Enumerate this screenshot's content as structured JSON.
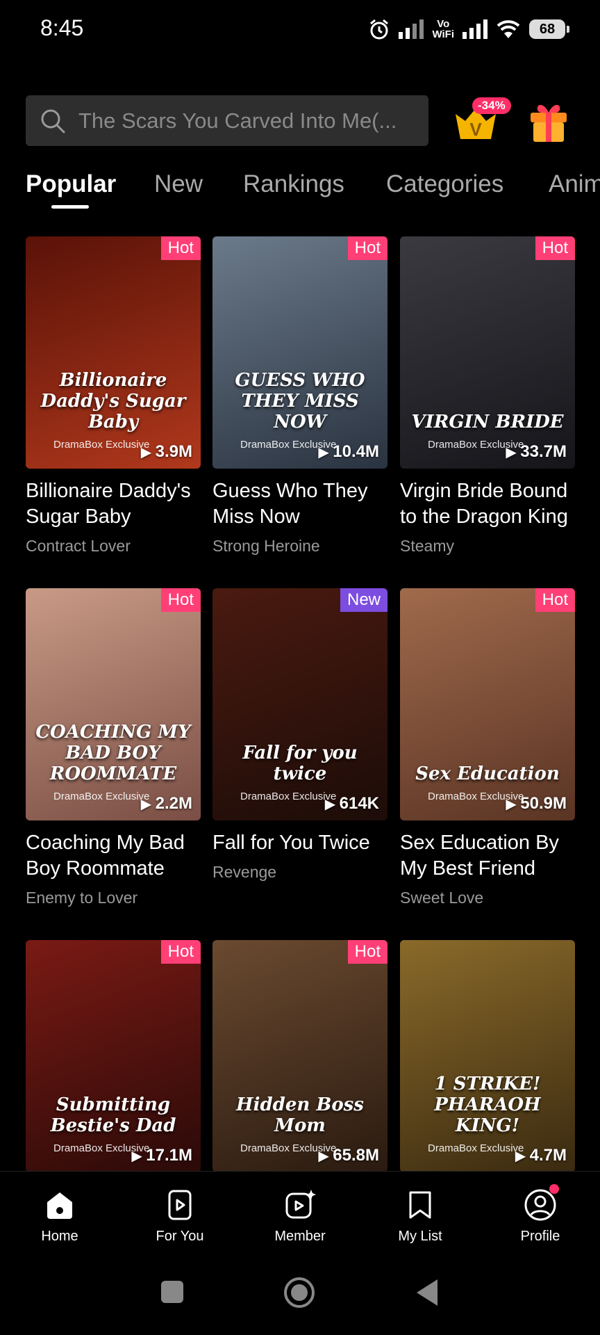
{
  "status": {
    "time": "8:45",
    "vowifi_top": "Vo",
    "vowifi_bottom": "WiFi",
    "battery": "68"
  },
  "search": {
    "placeholder": "The Scars You Carved Into Me(..."
  },
  "vip": {
    "discount": "-34%",
    "letter": "V"
  },
  "tabs": [
    {
      "label": "Popular"
    },
    {
      "label": "New"
    },
    {
      "label": "Rankings"
    },
    {
      "label": "Categories"
    },
    {
      "label": "Anim"
    }
  ],
  "exclusive_label": "DramaBox Exclusive",
  "cards": [
    {
      "title": "Billionaire Daddy's Sugar Baby",
      "tag": "Contract Lover",
      "badge": "Hot",
      "views": "3.9M",
      "cover_text": "Billionaire Daddy's Sugar Baby",
      "colors": [
        "#5a1208",
        "#b0381c"
      ]
    },
    {
      "title": "Guess Who They Miss Now",
      "tag": "Strong Heroine",
      "badge": "Hot",
      "views": "10.4M",
      "cover_text": "GUESS WHO THEY MISS NOW",
      "colors": [
        "#6b7a8a",
        "#2a3340"
      ]
    },
    {
      "title": "Virgin Bride Bound to the Dragon King",
      "tag": "Steamy",
      "badge": "Hot",
      "views": "33.7M",
      "cover_text": "VIRGIN BRIDE",
      "colors": [
        "#3a3a40",
        "#15151a"
      ]
    },
    {
      "title": "Coaching My Bad Boy Roommate",
      "tag": "Enemy to Lover",
      "badge": "Hot",
      "views": "2.2M",
      "cover_text": "COACHING MY BAD BOY ROOMMATE",
      "colors": [
        "#c89a86",
        "#7a4e44"
      ]
    },
    {
      "title": "Fall for You Twice",
      "tag": "Revenge",
      "badge": "New",
      "views": "614K",
      "cover_text": "Fall for you twice",
      "colors": [
        "#4a1a10",
        "#1c0c08"
      ]
    },
    {
      "title": "Sex Education By My Best Friend",
      "tag": "Sweet Love",
      "badge": "Hot",
      "views": "50.9M",
      "cover_text": "Sex Education",
      "colors": [
        "#a06a4c",
        "#5a3424"
      ]
    },
    {
      "title": "",
      "tag": "",
      "badge": "Hot",
      "views": "17.1M",
      "cover_text": "Submitting Bestie's Dad",
      "colors": [
        "#7a1a14",
        "#2a0a08"
      ]
    },
    {
      "title": "",
      "tag": "",
      "badge": "Hot",
      "views": "65.8M",
      "cover_text": "Hidden Boss Mom",
      "colors": [
        "#6a4a30",
        "#2a1a10"
      ]
    },
    {
      "title": "",
      "tag": "",
      "badge": "",
      "views": "4.7M",
      "cover_text": "1 STRIKE! PHARAOH KING!",
      "colors": [
        "#8a6a2a",
        "#3a2a10"
      ]
    }
  ],
  "nav": [
    {
      "label": "Home",
      "icon": "home-icon"
    },
    {
      "label": "For You",
      "icon": "play-square-icon"
    },
    {
      "label": "Member",
      "icon": "member-icon"
    },
    {
      "label": "My List",
      "icon": "bookmark-icon"
    },
    {
      "label": "Profile",
      "icon": "profile-icon"
    }
  ]
}
